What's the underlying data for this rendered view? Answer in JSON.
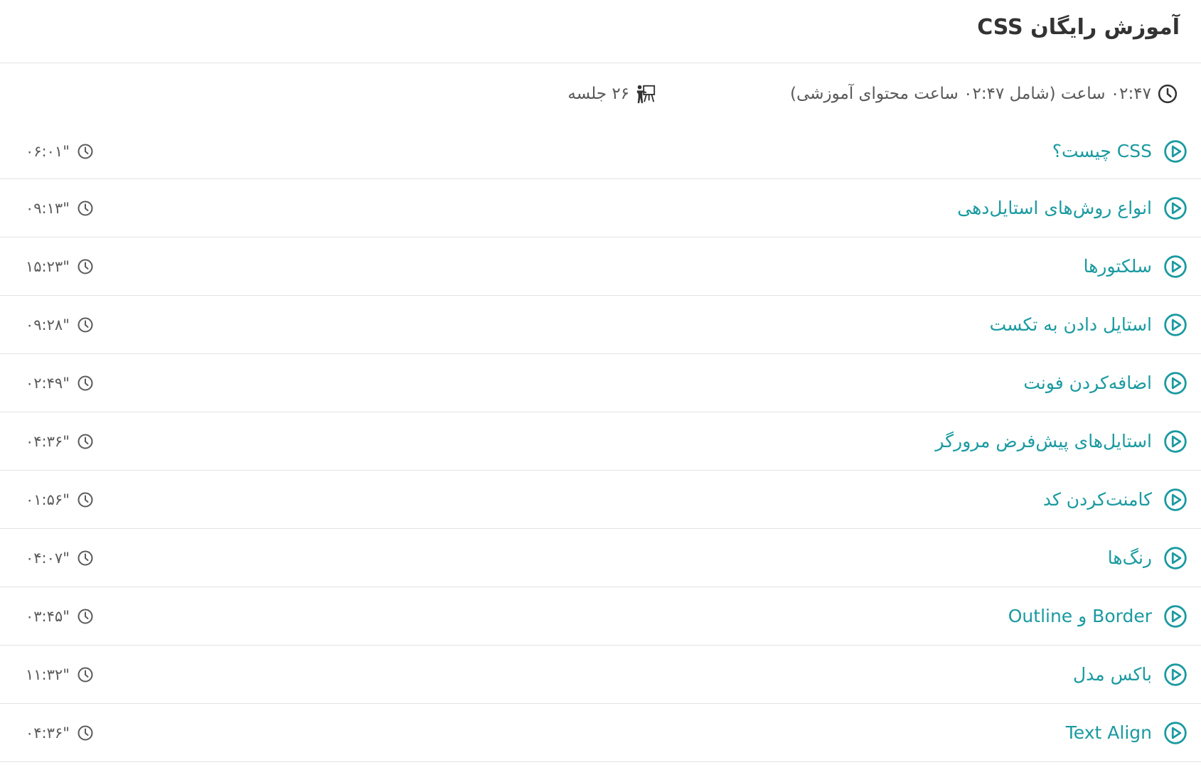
{
  "course": {
    "title": "آموزش رایگان CSS",
    "duration_text": "۰۲:۴۷ ساعت (شامل ۰۲:۴۷ ساعت محتوای آموزشی)",
    "sessions_text": "۲۶ جلسه"
  },
  "icons": {
    "duration": "clock-icon",
    "sessions": "teacher-board-icon",
    "lesson_play": "play-circle-icon",
    "lesson_duration": "clock-icon"
  },
  "colors": {
    "accent": "#1a9aa0",
    "text": "#3d3d3d",
    "muted": "#5a5a5a",
    "divider": "#e3e3e3"
  },
  "lessons": [
    {
      "title": "CSS چیست؟",
      "duration": "۰۶:۰۱\""
    },
    {
      "title": "انواع روش‌های استایل‌دهی",
      "duration": "۰۹:۱۳\""
    },
    {
      "title": "سلکتورها",
      "duration": "۱۵:۲۳\""
    },
    {
      "title": "استایل دادن به تکست",
      "duration": "۰۹:۲۸\""
    },
    {
      "title": "اضافه‌کردن فونت",
      "duration": "۰۲:۴۹\""
    },
    {
      "title": "استایل‌های پیش‌فرض مرورگر",
      "duration": "۰۴:۳۶\""
    },
    {
      "title": "کامنت‌کردن کد",
      "duration": "۰۱:۵۶\""
    },
    {
      "title": "رنگ‌ها",
      "duration": "۰۴:۰۷\""
    },
    {
      "title": "Border و Outline",
      "duration": "۰۳:۴۵\""
    },
    {
      "title": "باکس مدل",
      "duration": "۱۱:۳۲\""
    },
    {
      "title": "Text Align",
      "duration": "۰۴:۳۶\""
    }
  ]
}
